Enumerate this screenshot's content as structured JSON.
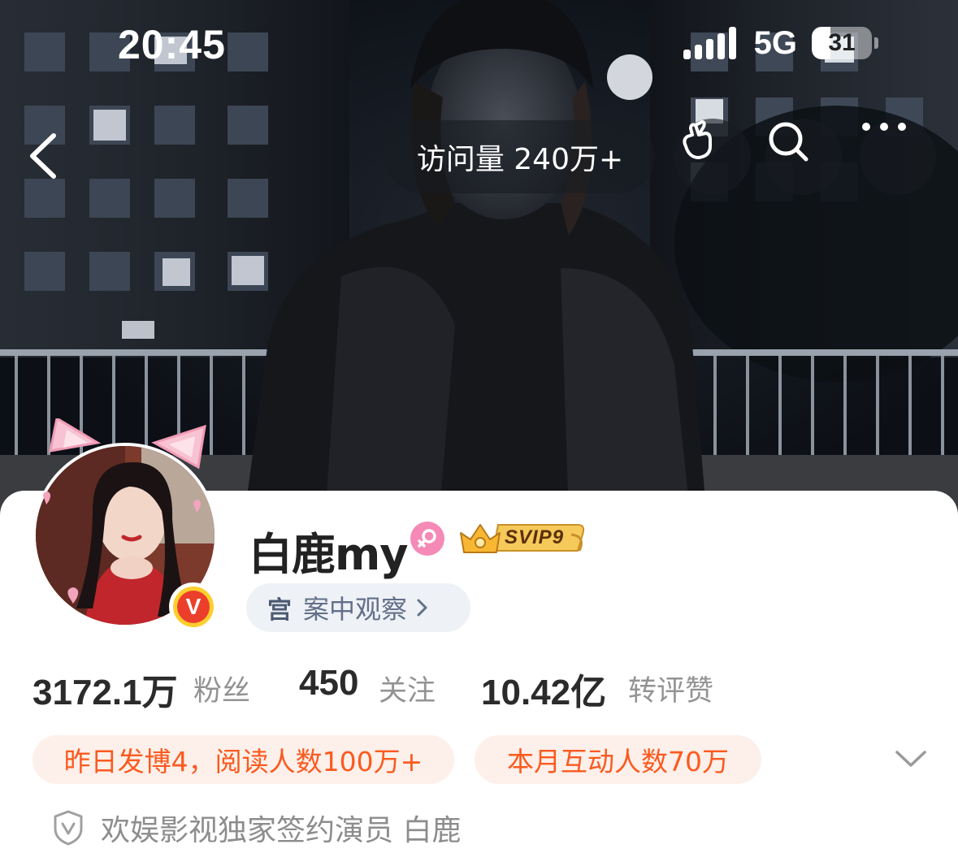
{
  "status_bar": {
    "time": "20:45",
    "network": "5G",
    "battery": "31",
    "battery_level": 0.31
  },
  "nav": {
    "visits_label": "访问量 240万+"
  },
  "profile": {
    "name": "白鹿my",
    "vip_badge": "SVIP9",
    "verify_mark": "V",
    "tag": {
      "icon_text": "宫",
      "label": "案中观察"
    },
    "stats": [
      {
        "value": "3172.1万",
        "label": "粉丝"
      },
      {
        "value": "450",
        "label": "关注"
      },
      {
        "value": "10.42亿",
        "label": "转评赞"
      }
    ],
    "chips": [
      "昨日发博4，阅读人数100万+",
      "本月互动人数70万"
    ],
    "certification": "欢娱影视独家签约演员 白鹿"
  },
  "icons": {
    "back": "chevron-left-icon",
    "gesture": "finger-heart-icon",
    "search": "search-icon",
    "more": "more-icon",
    "gender": "female-icon",
    "shield": "shield-v-icon",
    "expand": "chevron-down-icon"
  },
  "colors": {
    "accent_orange": "#fb5a1f",
    "chip_bg": "#fdf0ea",
    "tag_bg": "#eef1f6",
    "gender_pink": "#f58ab7",
    "verify_red": "#ec3f2b",
    "verify_gold": "#ffce2e"
  }
}
